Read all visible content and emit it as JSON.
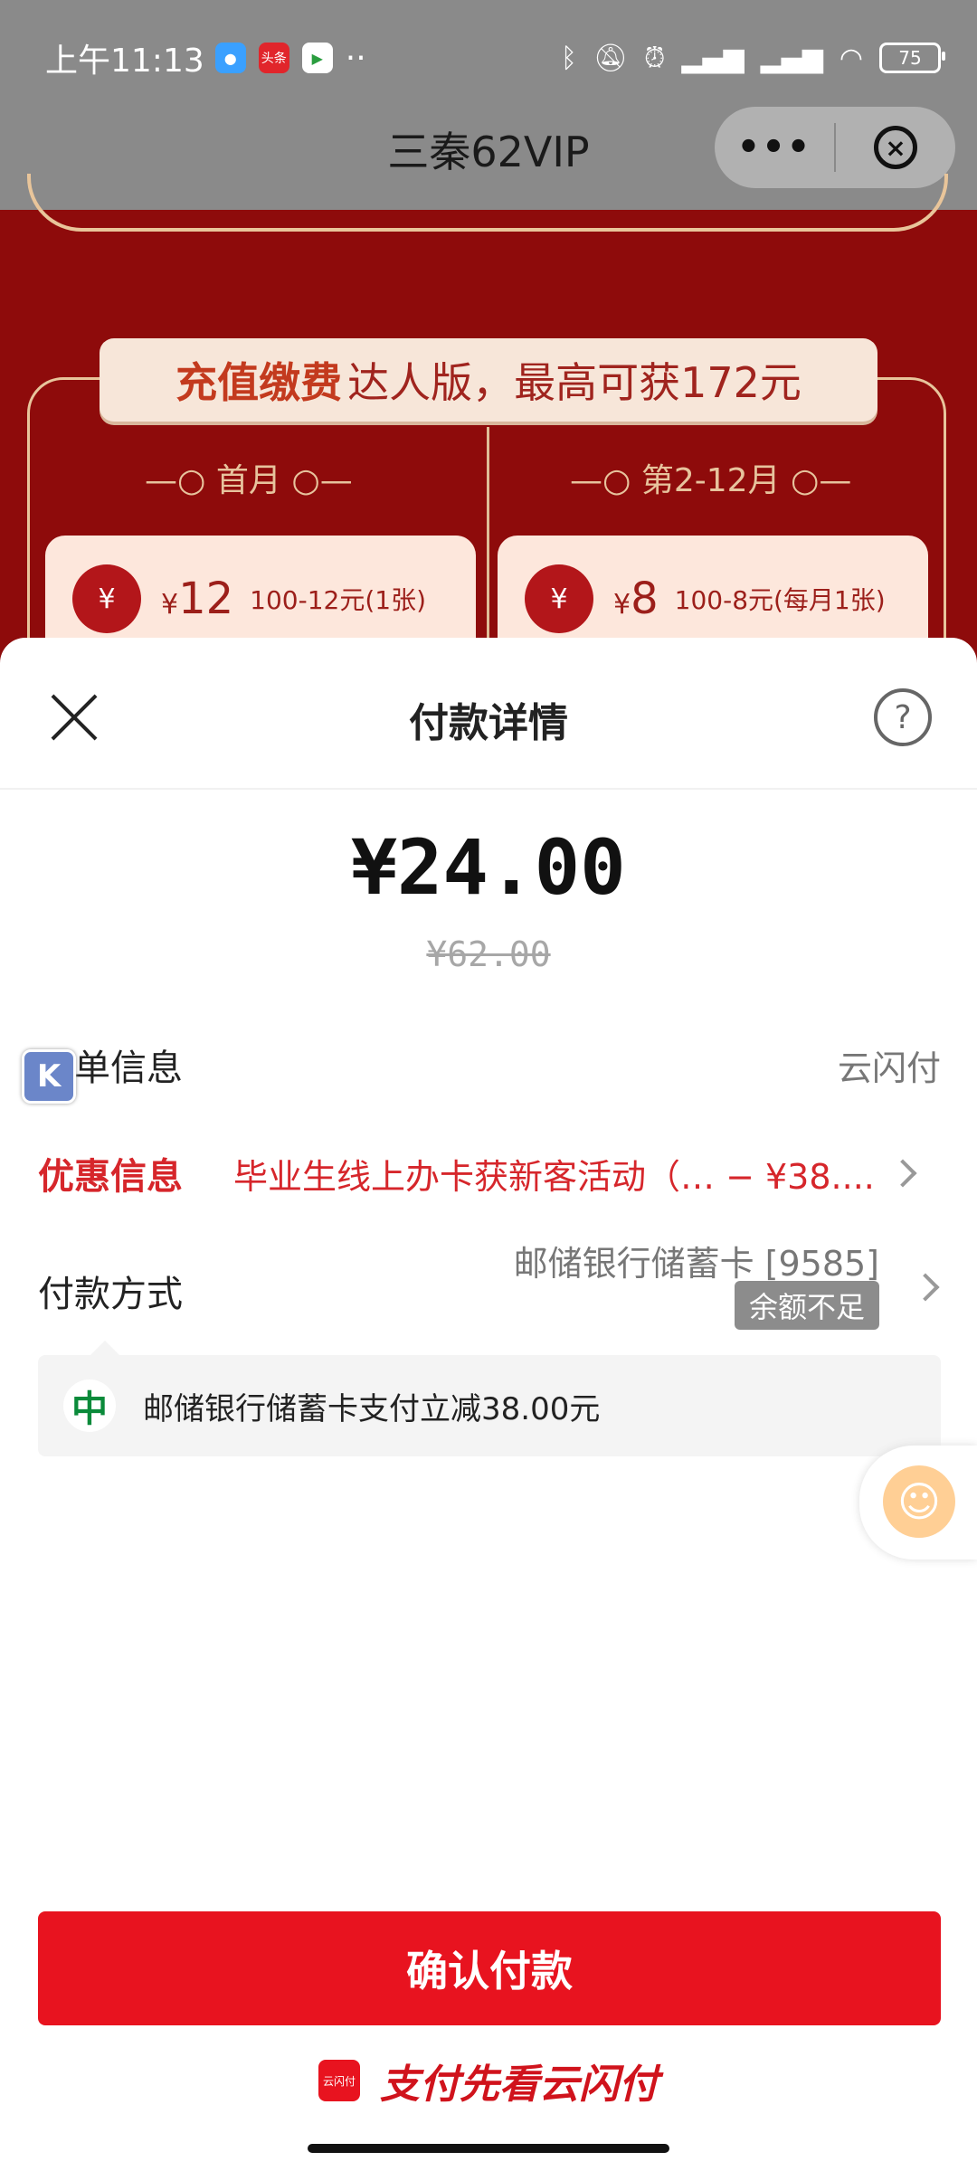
{
  "status_bar": {
    "time": "上午11:13",
    "notification_icons": [
      "chat-icon",
      "toutiao-icon",
      "play-store-icon"
    ],
    "toutiao_label": "头条",
    "dots": "··",
    "battery": "75"
  },
  "nav": {
    "title": "三秦62VIP",
    "more": "•••",
    "close": "×"
  },
  "background_promo": {
    "banner_highlight": "充值缴费",
    "banner_text": "达人版，最高可获172元",
    "tab_first": "首月",
    "tab_rest": "第2-12月",
    "card_first": {
      "currency": "¥",
      "amount": "12",
      "desc": "100-12元(1张)"
    },
    "card_rest": {
      "currency": "¥",
      "amount": "8",
      "desc": "100-8元(每月1张)"
    }
  },
  "sheet": {
    "title": "付款详情",
    "help": "?",
    "amount": "¥24.00",
    "original_amount": "¥62.00",
    "order_info": {
      "label": "订单信息",
      "value": "云闪付"
    },
    "discount_info": {
      "label": "优惠信息",
      "value": "毕业生线上办卡获新客活动（… − ¥38...."
    },
    "payment_method": {
      "label": "付款方式",
      "card": "邮储银行储蓄卡 [9585]",
      "badge": "余额不足"
    },
    "tip": "邮储银行储蓄卡支付立减38.00元",
    "confirm_button": "确认付款",
    "brand_slogan": "支付先看云闪付",
    "brand_logo_text": "云闪付"
  },
  "colors": {
    "accent_red": "#e8131f",
    "discount_red": "#d6262b",
    "promo_bg": "#8e0b0b"
  }
}
